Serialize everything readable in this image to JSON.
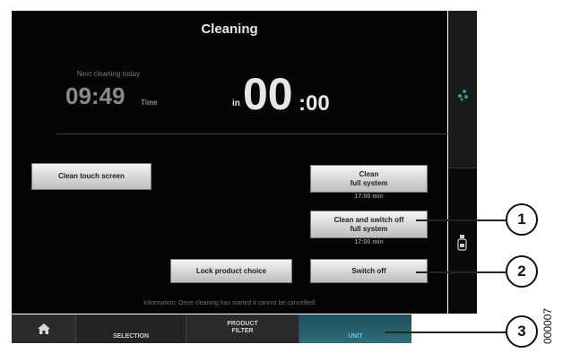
{
  "screen": {
    "title": "Cleaning",
    "next_cleaning_label": "Next cleaning today",
    "next_time": "09:49",
    "time_unit": "Time",
    "countdown_prefix": "in",
    "countdown_big": "00",
    "countdown_rest": ":00",
    "info_text": "Information: Once cleaning has started it cannot be cancelled!"
  },
  "buttons": {
    "clean_touch": "Clean touch screen",
    "clean_full_line1": "Clean",
    "clean_full_line2": "full system",
    "clean_full_duration": "17:00 min",
    "clean_switch_line1": "Clean and switch off",
    "clean_switch_line2": "full system",
    "clean_switch_duration": "17:00 min",
    "lock_product": "Lock product choice",
    "switch_off": "Switch off"
  },
  "tabs": {
    "home_icon": "home-icon",
    "selection": "SELECTION",
    "product_filter_line1": "PRODUCT",
    "product_filter_line2": "FILTER",
    "unit": "UNIT"
  },
  "callouts": [
    "1",
    "2",
    "3"
  ],
  "figure_ref": "000007",
  "colors": {
    "screen_bg": "#050505",
    "button_light": "#f4f4f4",
    "active_tab": "#2e6d7a",
    "unit_text": "#5fc9e0",
    "drops": "#2a9aa8"
  }
}
